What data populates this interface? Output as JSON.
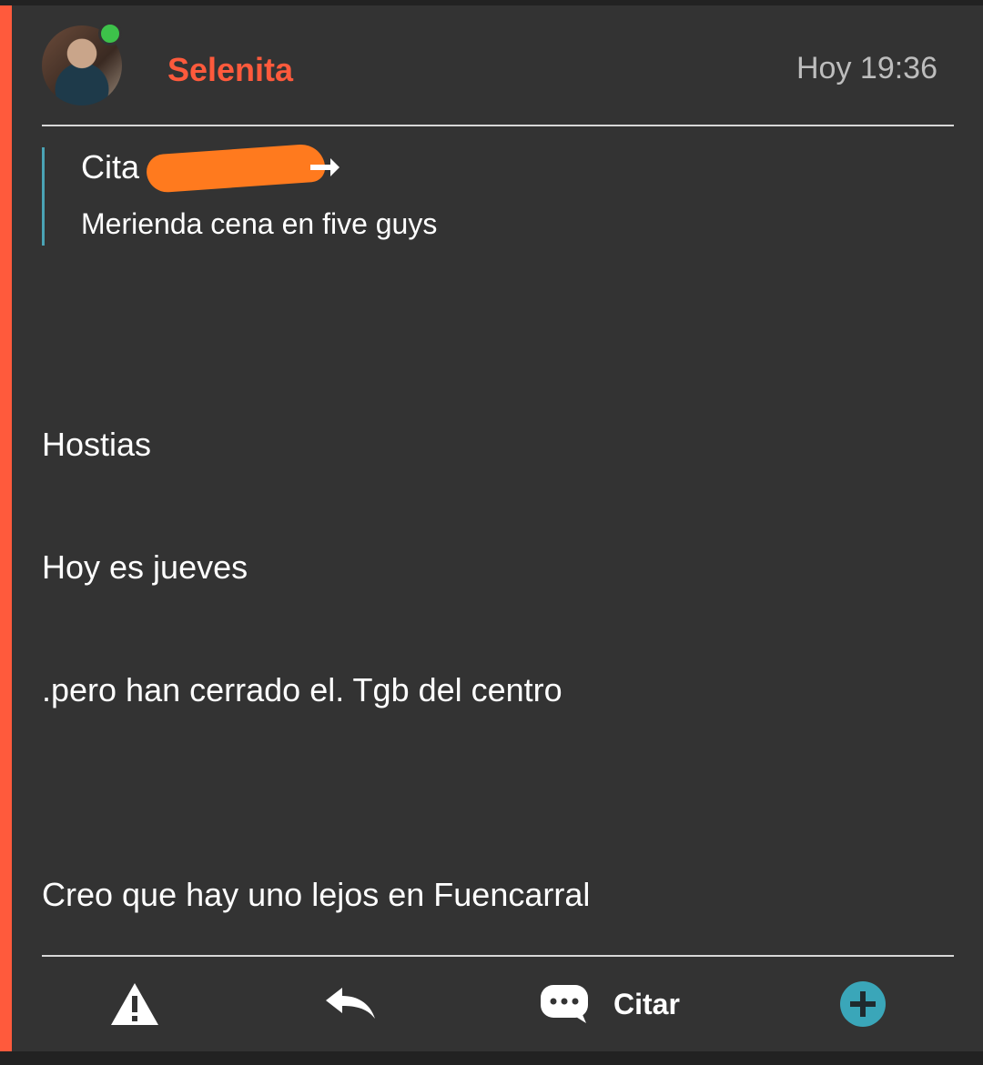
{
  "post": {
    "author": "Selenita",
    "time": "Hoy 19:36",
    "author_online": true
  },
  "quote": {
    "title": "Cita de",
    "text": "Merienda cena en five guys"
  },
  "messages": [
    "Hostias",
    "Hoy es jueves",
    ".pero han cerrado el. Tgb del centro",
    "Creo que hay uno lejos en Fuencarral"
  ],
  "actions": {
    "report_icon": "warning-icon",
    "reply_icon": "reply-icon",
    "quote_label": "Citar",
    "quote_icon": "speech-bubble-icon",
    "add_icon": "plus-circle-icon"
  },
  "colors": {
    "accent": "#ff5a3c",
    "quote_border": "#4aa3b5",
    "online": "#3dc24a",
    "add_button": "#3aa6b9",
    "redaction": "#ff7a1e"
  }
}
